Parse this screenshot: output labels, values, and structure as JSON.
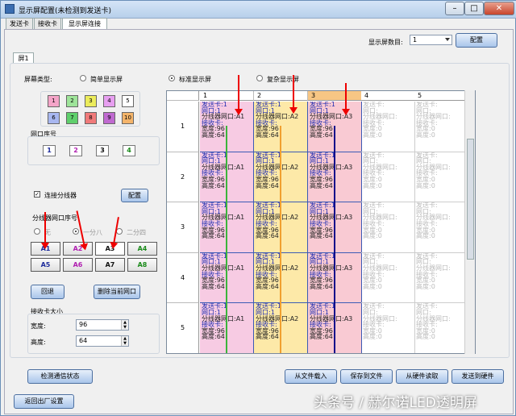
{
  "window": {
    "title": "显示屏配置(未检测到发送卡)",
    "min": "–",
    "max": "□",
    "close": "✕"
  },
  "tabs": [
    "发送卡",
    "接收卡",
    "显示屏连接"
  ],
  "screen_count": {
    "label": "显示屏数目:",
    "value": "1",
    "config_btn": "配置"
  },
  "screen_tab": "屏1",
  "screen_type": {
    "label": "屏幕类型:",
    "simple": "简单显示屏",
    "standard": "标准显示屏",
    "complex": "复杂显示屏"
  },
  "color_squares": [
    "1",
    "2",
    "3",
    "4",
    "5",
    "6",
    "7",
    "8",
    "9",
    "10"
  ],
  "square_colors": [
    "#f4a4c8",
    "#9ee49a",
    "#ecec5c",
    "#e79ff0",
    "#ffffff",
    "#a8b7f0",
    "#5fcf6c",
    "#f07a7a",
    "#c06ad0",
    "#f4b46a"
  ],
  "net_order": {
    "label": "网口序号",
    "ports": [
      "1",
      "2",
      "3",
      "4"
    ]
  },
  "connect_splitter": {
    "label": "连接分线器",
    "config_btn": "配置"
  },
  "splitter_ports": {
    "label": "分线器网口序号",
    "none": "无",
    "one_to_eight": "一分八",
    "one_to_four": "二分四",
    "buttons": [
      "A1",
      "A2",
      "A3",
      "A4",
      "A5",
      "A6",
      "A7",
      "A8"
    ]
  },
  "actions": {
    "undo": "回退",
    "delete_port": "删除当前网口"
  },
  "receiver_size": {
    "label": "接收卡大小",
    "width_label": "宽度:",
    "width": "96",
    "height_label": "高度:",
    "height": "64"
  },
  "grid": {
    "columns": [
      "1",
      "2",
      "3",
      "4",
      "5"
    ],
    "rows": [
      "1",
      "2",
      "3",
      "4",
      "5"
    ],
    "active": {
      "send_card": "发送卡:1",
      "net_port": "网口:1",
      "receive_card": "接收卡:",
      "width": "宽度:96",
      "height": "高度:64",
      "splitter": [
        "分线器网口:A1",
        "分线器网口:A2",
        "分线器网口:A3"
      ]
    },
    "inactive": {
      "send_card": "发送卡:",
      "net_port": "网口:",
      "splitter": "分线器网口:",
      "receive_card": "接收卡:",
      "width": "宽度:0",
      "height": "高度:0"
    }
  },
  "bottom": {
    "detect": "检测通信状态",
    "load_file": "从文件载入",
    "save_file": "保存到文件",
    "read_hw": "从硬件读取",
    "send_hw": "发送到硬件",
    "factory": "返回出厂设置"
  },
  "watermark": "头条号 / 赫尔诺LED透明屏"
}
